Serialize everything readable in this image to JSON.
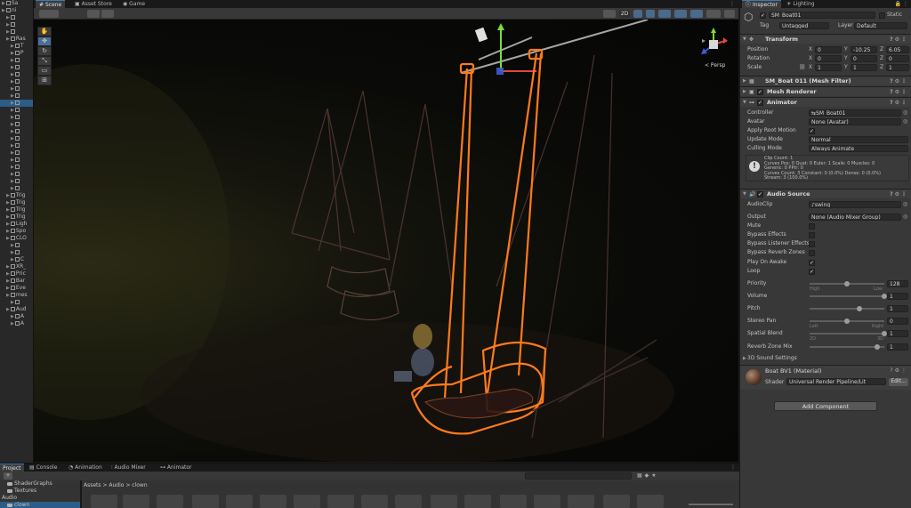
{
  "hierarchy": {
    "rows": [
      {
        "label": "Sa",
        "indent": 0,
        "selected": false
      },
      {
        "label": "ni",
        "indent": 0,
        "selected": false
      },
      {
        "label": "",
        "indent": 1,
        "selected": false
      },
      {
        "label": "",
        "indent": 1,
        "selected": false
      },
      {
        "label": "",
        "indent": 1,
        "selected": false
      },
      {
        "label": "Ras",
        "indent": 1,
        "selected": false
      },
      {
        "label": "T",
        "indent": 2,
        "selected": false
      },
      {
        "label": "P",
        "indent": 2,
        "selected": false
      },
      {
        "label": "",
        "indent": 2,
        "selected": false
      },
      {
        "label": "",
        "indent": 2,
        "selected": false
      },
      {
        "label": "",
        "indent": 2,
        "selected": false
      },
      {
        "label": "",
        "indent": 2,
        "selected": false
      },
      {
        "label": "",
        "indent": 2,
        "selected": false
      },
      {
        "label": "",
        "indent": 2,
        "selected": false
      },
      {
        "label": "",
        "indent": 2,
        "selected": true
      },
      {
        "label": "",
        "indent": 2,
        "selected": false
      },
      {
        "label": "",
        "indent": 2,
        "selected": false
      },
      {
        "label": "",
        "indent": 2,
        "selected": false
      },
      {
        "label": "",
        "indent": 2,
        "selected": false
      },
      {
        "label": "",
        "indent": 2,
        "selected": false
      },
      {
        "label": "",
        "indent": 2,
        "selected": false
      },
      {
        "label": "",
        "indent": 2,
        "selected": false
      },
      {
        "label": "",
        "indent": 2,
        "selected": false
      },
      {
        "label": "",
        "indent": 2,
        "selected": false
      },
      {
        "label": "",
        "indent": 2,
        "selected": false
      },
      {
        "label": "",
        "indent": 2,
        "selected": false
      },
      {
        "label": "",
        "indent": 2,
        "selected": false
      },
      {
        "label": "Trig",
        "indent": 1,
        "selected": false
      },
      {
        "label": "Trig",
        "indent": 1,
        "selected": false
      },
      {
        "label": "Trig",
        "indent": 1,
        "selected": false
      },
      {
        "label": "Trig",
        "indent": 1,
        "selected": false
      },
      {
        "label": "Ligh",
        "indent": 1,
        "selected": false
      },
      {
        "label": "Spo",
        "indent": 1,
        "selected": false
      },
      {
        "label": "CLO",
        "indent": 1,
        "selected": false
      },
      {
        "label": "",
        "indent": 2,
        "selected": false
      },
      {
        "label": "",
        "indent": 2,
        "selected": false
      },
      {
        "label": "C",
        "indent": 2,
        "selected": false
      },
      {
        "label": "XR_",
        "indent": 1,
        "selected": false
      },
      {
        "label": "Pric",
        "indent": 1,
        "selected": false
      },
      {
        "label": "Bar",
        "indent": 1,
        "selected": false
      },
      {
        "label": "Eve",
        "indent": 1,
        "selected": false
      },
      {
        "label": "mes",
        "indent": 1,
        "selected": false
      },
      {
        "label": "",
        "indent": 2,
        "selected": false
      },
      {
        "label": "Aud",
        "indent": 1,
        "selected": false
      },
      {
        "label": "A",
        "indent": 2,
        "selected": false
      },
      {
        "label": "A",
        "indent": 2,
        "selected": false
      }
    ]
  },
  "scene_tabs": [
    "Scene",
    "Asset Store",
    "Game"
  ],
  "scene_toolbar": {
    "mode_2d": "2D"
  },
  "viewport": {
    "camera_label": "< Persp"
  },
  "inspector": {
    "tabs": [
      "Inspector",
      "Lighting"
    ],
    "object_name": "SM_Boat01",
    "static_label": "Static",
    "tag_label": "Tag",
    "tag_value": "Untagged",
    "layer_label": "Layer",
    "layer_value": "Default",
    "transform": {
      "title": "Transform",
      "position": {
        "label": "Position",
        "x": "0",
        "y": "-10.25",
        "z": "6.05"
      },
      "rotation": {
        "label": "Rotation",
        "x": "0",
        "y": "0",
        "z": "0"
      },
      "scale": {
        "label": "Scale",
        "x": "1",
        "y": "1",
        "z": "1"
      }
    },
    "mesh_filter": {
      "title": "SM_Boat 011 (Mesh Filter)"
    },
    "mesh_renderer": {
      "title": "Mesh Renderer"
    },
    "animator": {
      "title": "Animator",
      "controller_label": "Controller",
      "controller_value": "SM_Boat01",
      "avatar_label": "Avatar",
      "avatar_value": "None (Avatar)",
      "apply_root_motion_label": "Apply Root Motion",
      "update_mode_label": "Update Mode",
      "update_mode_value": "Normal",
      "culling_mode_label": "Culling Mode",
      "culling_mode_value": "Always Animate",
      "info_lines": [
        "Clip Count: 1",
        "Curves Pos: 0 Quat: 0 Euler: 1 Scale: 0 Muscles: 0",
        "Generic: 0 PPtr: 0",
        "Curves Count: 3 Constant: 0 (0.0%) Dense: 0 (0.0%)",
        "Stream: 3 (100.0%)"
      ]
    },
    "audio_source": {
      "title": "Audio Source",
      "audioclip_label": "AudioClip",
      "audioclip_value": "swing",
      "output_label": "Output",
      "output_value": "None (Audio Mixer Group)",
      "mute_label": "Mute",
      "bypass_effects_label": "Bypass Effects",
      "bypass_listener_label": "Bypass Listener Effects",
      "bypass_reverb_label": "Bypass Reverb Zones",
      "play_on_awake_label": "Play On Awake",
      "loop_label": "Loop",
      "priority": {
        "label": "Priority",
        "value": "128",
        "min_label": "High",
        "max_label": "Low",
        "fraction": 0.5
      },
      "volume": {
        "label": "Volume",
        "value": "1",
        "fraction": 1.0
      },
      "pitch": {
        "label": "Pitch",
        "value": "1",
        "fraction": 0.67
      },
      "stereo_pan": {
        "label": "Stereo Pan",
        "value": "0",
        "min_label": "Left",
        "max_label": "Right",
        "fraction": 0.5
      },
      "spatial_blend": {
        "label": "Spatial Blend",
        "value": "1",
        "min_label": "2D",
        "max_label": "3D",
        "fraction": 1.0
      },
      "reverb_zone_mix": {
        "label": "Reverb Zone Mix",
        "value": "1",
        "fraction": 0.91
      },
      "sound_settings_label": "3D Sound Settings"
    },
    "material": {
      "title": "Boat BV1 (Material)",
      "shader_label": "Shader",
      "shader_value": "Universal Render Pipeline/Lit",
      "edit_label": "Edit..."
    },
    "add_component_label": "Add Component"
  },
  "bottom": {
    "tabs": [
      "Project",
      "Console",
      "Animation",
      "Audio Mixer",
      "Animator"
    ],
    "breadcrumb": [
      "Assets",
      "Audio",
      "clown"
    ],
    "tree": [
      {
        "label": "ShaderGraphs",
        "selected": false
      },
      {
        "label": "Textures",
        "selected": false
      },
      {
        "label": "Audio",
        "selected": false
      },
      {
        "label": "clown",
        "selected": true
      }
    ]
  },
  "colors": {
    "accent_blue": "#2c5d87",
    "highlight_orange": "#ff7a1a",
    "panel": "#383838",
    "dark": "#191919"
  }
}
